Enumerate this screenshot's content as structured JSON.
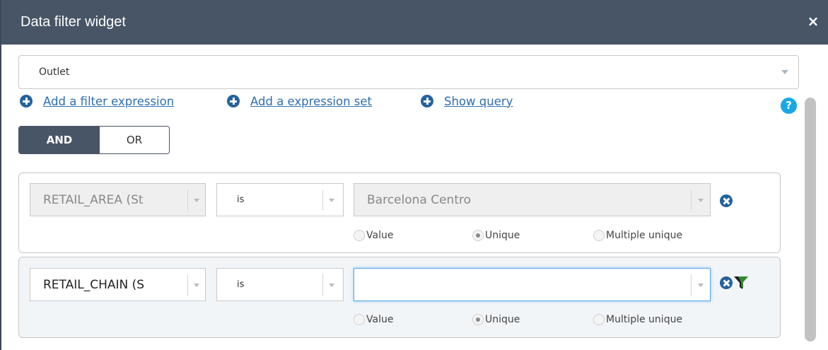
{
  "window": {
    "title": "Data filter widget",
    "close_label": "×"
  },
  "layer_select": {
    "value": "Outlet"
  },
  "links": [
    {
      "label": "Add a filter expression"
    },
    {
      "label": "Add a expression set"
    },
    {
      "label": "Show query"
    }
  ],
  "help": {
    "label": "?"
  },
  "logic": {
    "and_label": "AND",
    "or_label": "OR",
    "selected": "AND"
  },
  "expressions": [
    {
      "field": "RETAIL_AREA (St",
      "operator": "is",
      "value": "Barcelona Centro",
      "radio_value": "Value",
      "radio_unique": "Unique",
      "radio_multiple": "Multiple unique",
      "selected_mode": "Unique"
    },
    {
      "field": "RETAIL_CHAIN (S",
      "operator": "is",
      "value": "",
      "radio_value": "Value",
      "radio_unique": "Unique",
      "radio_multiple": "Multiple unique",
      "selected_mode": "Unique"
    }
  ],
  "colors": {
    "titlebar": "#485566",
    "link": "#2f6fb0",
    "icon_blue": "#24629e",
    "help_icon": "#18a8e8",
    "funnel_green": "#2e8b2e"
  }
}
